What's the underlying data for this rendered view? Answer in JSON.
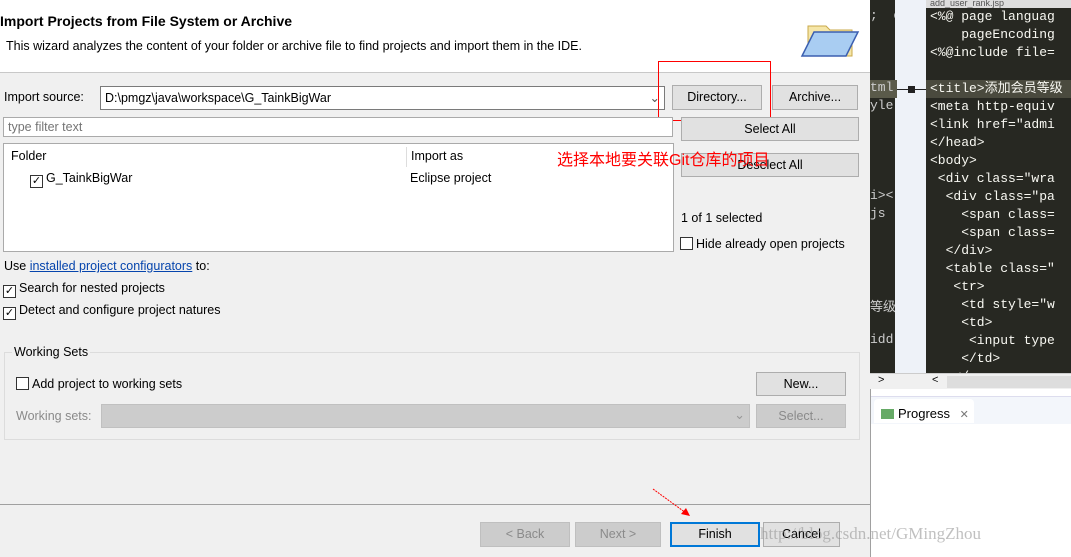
{
  "dialog": {
    "title": "Import Projects from File System or Archive",
    "description": "This wizard analyzes the content of your folder or archive file to find projects and import them in the IDE.",
    "import_source_label": "Import source:",
    "import_source_value": "D:\\pmgz\\java\\workspace\\G_TainkBigWar",
    "directory_button": "Directory...",
    "archive_button": "Archive...",
    "filter_placeholder": "type filter text",
    "select_all": "Select All",
    "deselect_all": "Deselect All",
    "columns": [
      "Folder",
      "Import as"
    ],
    "rows": [
      {
        "folder": "G_TainkBigWar",
        "import_as": "Eclipse project",
        "checked": true
      }
    ],
    "selected_count": "1 of 1 selected",
    "hide_open": "Hide already open projects",
    "use_prefix": "Use ",
    "configurators_link": "installed project configurators",
    "use_suffix": " to:",
    "search_nested": "Search for nested projects",
    "detect_natures": "Detect and configure project natures",
    "working_sets_group": "Working Sets",
    "add_to_working_sets": "Add project to working sets",
    "new_button": "New...",
    "working_sets_label": "Working sets:",
    "select_button": "Select...",
    "back_button": "< Back",
    "next_button": "Next >",
    "finish_button": "Finish",
    "cancel_button": "Cancel"
  },
  "annotation": {
    "note": "选择本地要关联Git仓库的项目",
    "color": "#ff0000"
  },
  "watermark": "http://blog.csdn.net/GMingZhou",
  "editor": {
    "tab_title": "add_user_rank.jsp",
    "left_fragments": [
      ";  c",
      "",
      "",
      "",
      "tml",
      "yle",
      "",
      "",
      "",
      "",
      "i><",
      "js",
      "",
      "",
      "",
      "",
      "等级",
      "",
      "idd"
    ],
    "lines": [
      "<%@ page languag",
      "    pageEncoding",
      "<%@include file=",
      "",
      "<title>添加会员等级",
      "<meta http-equiv",
      "<link href=\"admi",
      "</head>",
      "<body>",
      " <div class=\"wra",
      "  <div class=\"pa",
      "    <span class=",
      "    <span class=",
      "  </div>",
      "  <table class=\"",
      "   <tr>",
      "    <td style=\"w",
      "    <td>",
      "     <input type",
      "    </td>",
      "   </"
    ]
  },
  "progress_tab": "Progress"
}
